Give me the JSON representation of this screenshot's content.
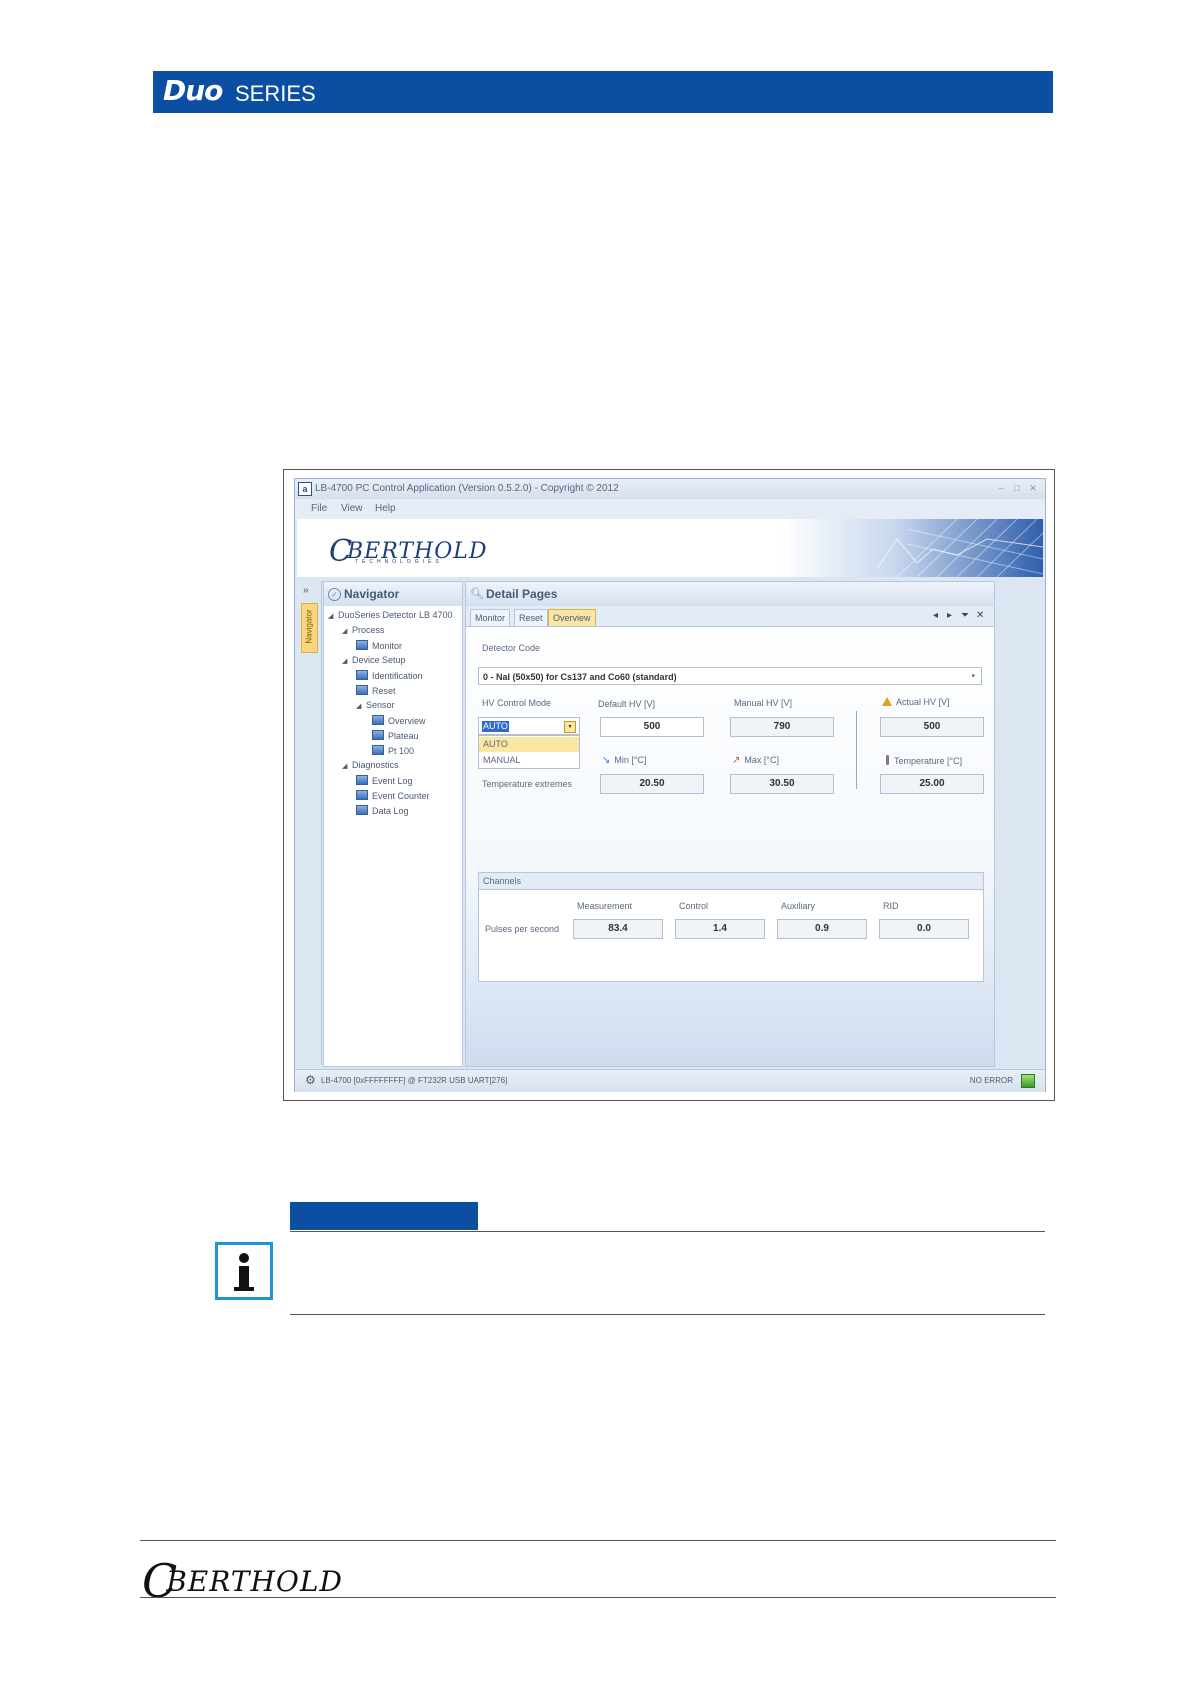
{
  "header": {
    "brand_duo": "Duo",
    "brand_series": "SERIES"
  },
  "app": {
    "title": "LB-4700 PC Control Application (Version 0.5.2.0) - Copyright ©  2012",
    "menu": [
      "File",
      "View",
      "Help"
    ],
    "logo": {
      "text": "BERTHOLD",
      "tagline": "TECHNOLOGIES"
    },
    "navigator": {
      "title": "Navigator",
      "tab_label": "Navigator",
      "tree": [
        "DuoSeries Detector LB 4700",
        "Process",
        "Monitor",
        "Device Setup",
        "Identification",
        "Reset",
        "Sensor",
        "Overview",
        "Plateau",
        "Pt 100",
        "Diagnostics",
        "Event Log",
        "Event Counter",
        "Data Log"
      ]
    },
    "detail": {
      "title": "Detail Pages",
      "tabs": [
        "Monitor",
        "Reset",
        "Overview"
      ],
      "active_tab": "Overview",
      "detector_code_label": "Detector Code",
      "detector_code_value": "0  -  NaI (50x50) for Cs137 and Co60 (standard)",
      "hv_control_mode_label": "HV Control Mode",
      "hv_control_mode_value": "AUTO",
      "hv_control_mode_options": [
        "AUTO",
        "MANUAL"
      ],
      "default_hv_label": "Default HV  [V]",
      "default_hv_value": "500",
      "manual_hv_label": "Manual HV  [V]",
      "manual_hv_value": "790",
      "actual_hv_label": "Actual HV  [V]",
      "actual_hv_value": "500",
      "temp_extremes_label": "Temperature extremes",
      "min_label": "Min  [°C]",
      "min_value": "20.50",
      "max_label": "Max  [°C]",
      "max_value": "30.50",
      "temperature_label": "Temperature  [°C]",
      "temperature_value": "25.00",
      "channels": {
        "title": "Channels",
        "row_label": "Pulses per second",
        "columns": [
          "Measurement",
          "Control",
          "Auxiliary",
          "RID"
        ],
        "values": [
          "83.4",
          "1.4",
          "0.9",
          "0.0"
        ]
      }
    },
    "status": {
      "connection": "LB-4700 [0xFFFFFFFF] @ FT232R USB UART[276]",
      "error": "NO ERROR"
    }
  },
  "footer": {
    "logo": "BERTHOLD"
  },
  "colors": {
    "brand_blue": "#0b4fa3",
    "info_blue": "#1f95d8",
    "tab_active": "#fbe6a3"
  }
}
